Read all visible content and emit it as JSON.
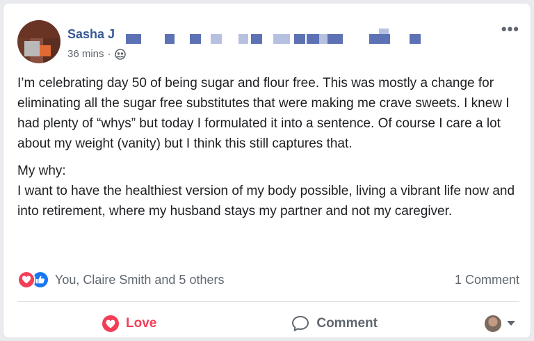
{
  "post": {
    "author": "Sasha J",
    "timestamp": "36 mins",
    "separator": "·",
    "audience_icon": "friends-icon",
    "more_label": "•••",
    "paragraphs": [
      "I’m celebrating day 50 of being sugar and flour free. This was mostly a change for eliminating all the sugar free substitutes that were making me crave sweets. I knew I had plenty of “whys” but today I formulated it into a sentence. Of course I care a lot about my weight (vanity) but I think this still captures that.",
      "My why:",
      "I want to have the healthiest version of my body possible, living a vibrant life now and into retirement, where my husband stays my partner and not my caregiver."
    ]
  },
  "reactions": {
    "icons": [
      "heart-icon",
      "thumbs-up-icon"
    ],
    "summary": "You, Claire Smith and 5 others",
    "comments": "1 Comment"
  },
  "actions": {
    "love_label": "Love",
    "comment_label": "Comment"
  },
  "colors": {
    "love": "#f33e58",
    "like": "#1877f2",
    "author_link": "#385898",
    "secondary_text": "#606770"
  }
}
